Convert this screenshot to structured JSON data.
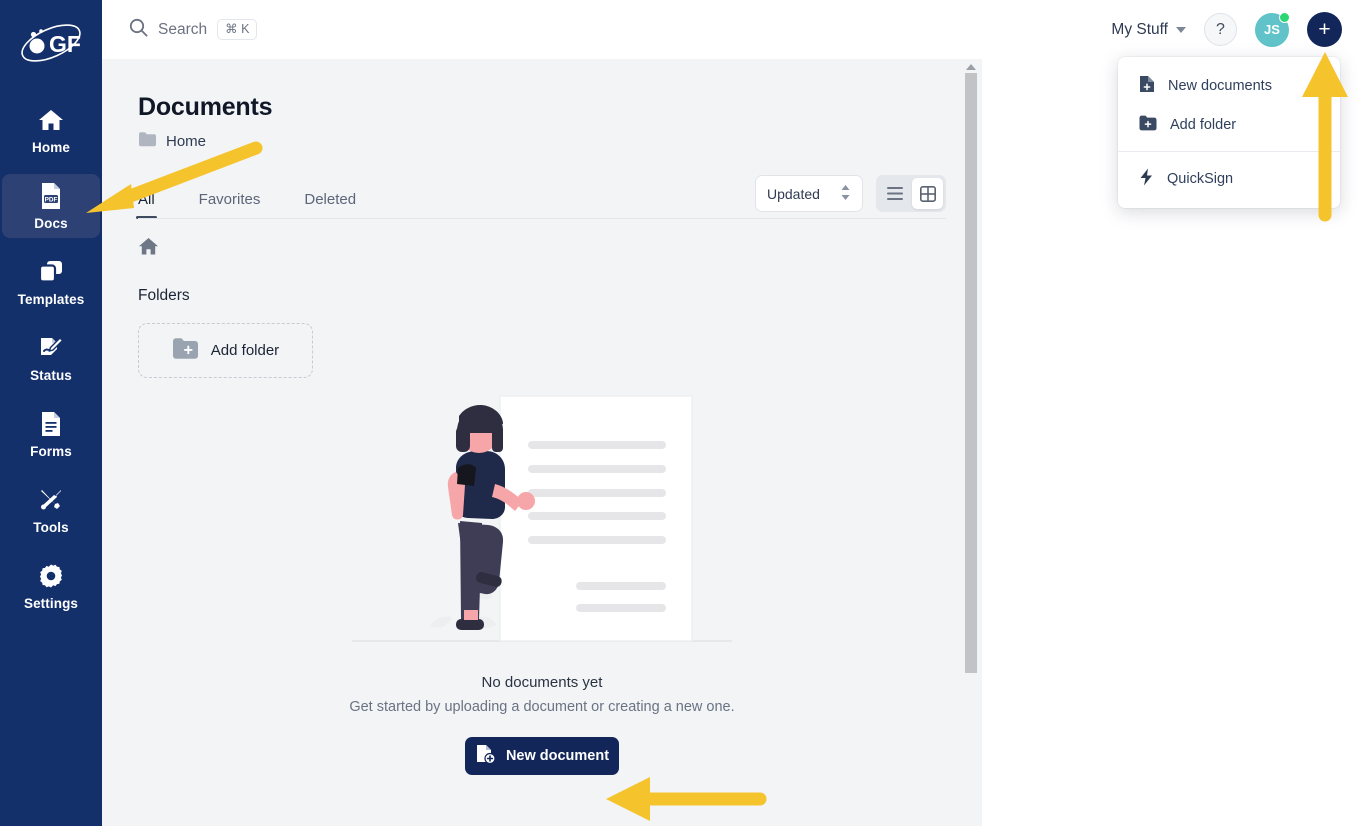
{
  "brand": {
    "logo_text": "GF",
    "sidebar_bg": "#14306B",
    "accent": "#12265A",
    "arrow_color": "#F5C32C"
  },
  "sidebar": {
    "items": [
      {
        "label": "Home",
        "icon": "home-icon",
        "active": false
      },
      {
        "label": "Docs",
        "icon": "pdf-file-icon",
        "active": true
      },
      {
        "label": "Templates",
        "icon": "templates-icon",
        "active": false
      },
      {
        "label": "Status",
        "icon": "status-signature-icon",
        "active": false
      },
      {
        "label": "Forms",
        "icon": "forms-icon",
        "active": false
      },
      {
        "label": "Tools",
        "icon": "tools-icon",
        "active": false
      },
      {
        "label": "Settings",
        "icon": "gear-icon",
        "active": false
      }
    ]
  },
  "topbar": {
    "search_label": "Search",
    "search_shortcut": "⌘ K",
    "my_stuff_label": "My Stuff",
    "help_label": "?",
    "avatar_initials": "JS",
    "avatar_status": "online",
    "plus_label": "+"
  },
  "dropdown": {
    "items": [
      {
        "label": "New documents",
        "icon": "new-document-icon"
      },
      {
        "label": "Add folder",
        "icon": "add-folder-icon"
      },
      {
        "label": "QuickSign",
        "icon": "lightning-bolt-icon"
      }
    ]
  },
  "main": {
    "title": "Documents",
    "breadcrumb": "Home",
    "tabs": [
      {
        "label": "All",
        "active": true
      },
      {
        "label": "Favorites",
        "active": false
      },
      {
        "label": "Deleted",
        "active": false
      }
    ],
    "sort_value": "Updated",
    "view_modes": [
      {
        "name": "list-view",
        "active": false
      },
      {
        "name": "grid-view",
        "active": true
      }
    ],
    "folders_label": "Folders",
    "add_folder_label": "Add folder",
    "empty_title": "No documents yet",
    "empty_subtitle": "Get started by uploading a document or creating a new one.",
    "new_document_label": "New document"
  }
}
